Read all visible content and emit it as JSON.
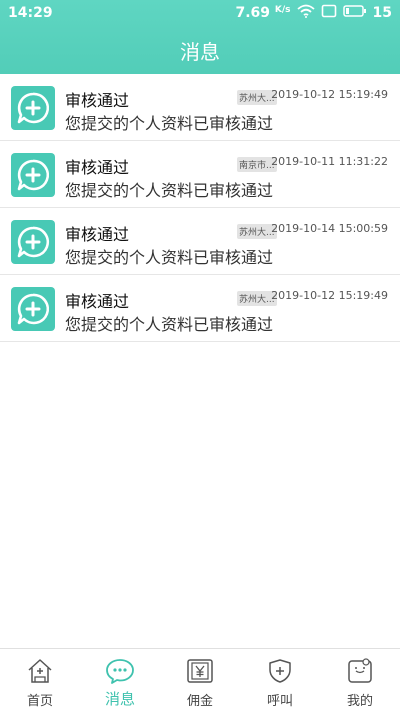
{
  "status_bar": {
    "time": "14:29",
    "speed": "7.69",
    "speed_unit": "K/s",
    "battery": "15",
    "icons": [
      "wifi-icon",
      "screen-icon",
      "battery-icon"
    ]
  },
  "header": {
    "title": "消息"
  },
  "messages": [
    {
      "title": "审核通过",
      "desc": "您提交的个人资料已审核通过",
      "tag": "苏州大...",
      "time": "2019-10-12 15:19:49",
      "icon": "message-plus-icon"
    },
    {
      "title": "审核通过",
      "desc": "您提交的个人资料已审核通过",
      "tag": "南京市...",
      "time": "2019-10-11 11:31:22",
      "icon": "message-plus-icon"
    },
    {
      "title": "审核通过",
      "desc": "您提交的个人资料已审核通过",
      "tag": "苏州大...",
      "time": "2019-10-14 15:00:59",
      "icon": "message-plus-icon"
    },
    {
      "title": "审核通过",
      "desc": "您提交的个人资料已审核通过",
      "tag": "苏州大...",
      "time": "2019-10-12 15:19:49",
      "icon": "message-plus-icon"
    }
  ],
  "tabbar": {
    "items": [
      {
        "label": "首页",
        "icon": "home-icon"
      },
      {
        "label": "消息",
        "icon": "chat-icon",
        "active": true
      },
      {
        "label": "佣金",
        "icon": "yen-icon"
      },
      {
        "label": "呼叫",
        "icon": "shield-plus-icon"
      },
      {
        "label": "我的",
        "icon": "profile-icon"
      }
    ]
  },
  "colors": {
    "accent": "#48c9b5",
    "header_gradient_top": "#5fd6c2",
    "header_gradient_bottom": "#52cdb8"
  }
}
